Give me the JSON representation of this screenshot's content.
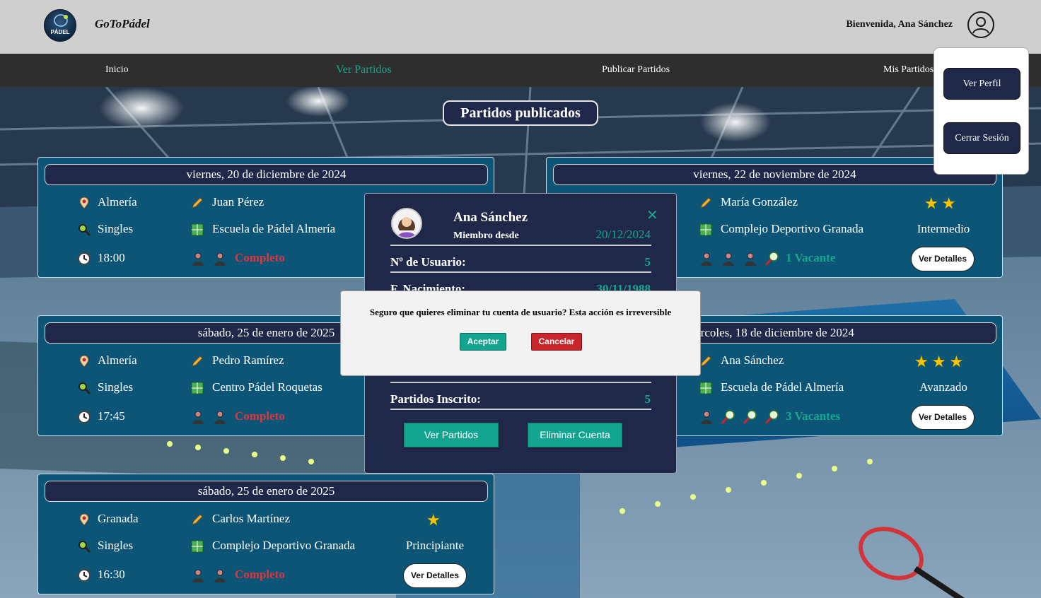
{
  "header": {
    "logo_text": "PÁDEL",
    "brand": "GoToPádel",
    "welcome": "Bienvenida, Ana Sánchez"
  },
  "nav": {
    "items": [
      "Inicio",
      "Ver Partidos",
      "Publicar Partidos",
      "Mis Partidos"
    ],
    "active": "Ver Partidos"
  },
  "main": {
    "title": "Partidos publicados"
  },
  "cards": [
    {
      "date": "viernes, 20 de diciembre de 2024",
      "city": "Almería",
      "organizer": "Juan Pérez",
      "type": "Singles",
      "venue": "Escuela de Pádel Almería",
      "time": "18:00",
      "status": "Completo",
      "players": 2,
      "vacancies": 0
    },
    {
      "date": "viernes, 22 de noviembre de 2024",
      "organizer": "María González",
      "venue": "Complejo Deportivo Granada",
      "stars": 2,
      "level": "Intermedio",
      "status": "1 Vacante",
      "players": 3,
      "vacancies": 1,
      "details": "Ver Detalles"
    },
    {
      "date": "sábado, 25 de enero de 2025",
      "city": "Almería",
      "organizer": "Pedro Ramírez",
      "type": "Singles",
      "venue": "Centro Pádel Roquetas",
      "time": "17:45",
      "status": "Completo",
      "players": 2,
      "vacancies": 0
    },
    {
      "date": "ercoles, 18 de diciembre de 2024",
      "organizer": "Ana Sánchez",
      "venue": "Escuela de Pádel Almería",
      "stars": 3,
      "level": "Avanzado",
      "status": "3 Vacantes",
      "players": 1,
      "vacancies": 3,
      "details": "Ver Detalles"
    },
    {
      "date": "sábado, 25 de enero de 2025",
      "city": "Granada",
      "organizer": "Carlos Martínez",
      "type": "Singles",
      "venue": "Complejo Deportivo Granada",
      "time": "16:30",
      "status": "Completo",
      "stars": 1,
      "level": "Principiante",
      "details": "Ver Detalles",
      "players": 2,
      "vacancies": 0
    }
  ],
  "profile": {
    "name": "Ana Sánchez",
    "member_label": "Miembro desde",
    "member_since": "20/12/2024",
    "user_no_label": "Nº de Usuario:",
    "user_no": "5",
    "birth_label": "F. Nacimiento:",
    "birth": "30/11/1988",
    "registered_label": "Partidos Inscrito:",
    "registered": "5",
    "btn_matches": "Ver Partidos",
    "btn_delete": "Eliminar Cuenta"
  },
  "confirm": {
    "message": "Seguro que quieres eliminar tu cuenta de usuario? Esta acción es irreversible",
    "accept": "Aceptar",
    "cancel": "Cancelar"
  },
  "dropdown": {
    "profile": "Ver Perfil",
    "logout": "Cerrar Sesión"
  },
  "colors": {
    "accent": "#16a88f",
    "navy": "#1f2848",
    "card": "#0d5576",
    "full": "#e0353a",
    "star": "#f5c400"
  }
}
